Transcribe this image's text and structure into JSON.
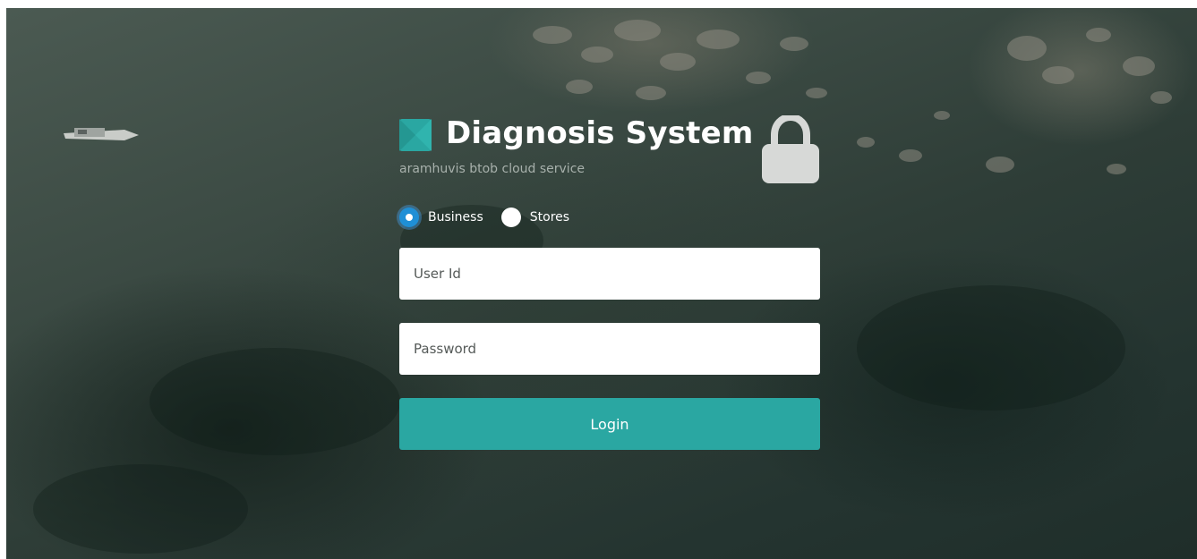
{
  "brand": {
    "title": "Diagnosis System",
    "subtitle": "aramhuvis btob cloud service",
    "logo_icon": "logo-square-icon",
    "lock_icon": "lock-icon"
  },
  "login_type": {
    "options": [
      {
        "label": "Business",
        "selected": true
      },
      {
        "label": "Stores",
        "selected": false
      }
    ]
  },
  "form": {
    "user_id_placeholder": "User Id",
    "user_id_value": "",
    "password_placeholder": "Password",
    "password_value": "",
    "login_label": "Login"
  },
  "colors": {
    "accent": "#2aa7a2",
    "radio_selected": "#1f8fd6",
    "text_on_dark": "#ffffff",
    "subtitle_text": "#a7b0ab"
  }
}
